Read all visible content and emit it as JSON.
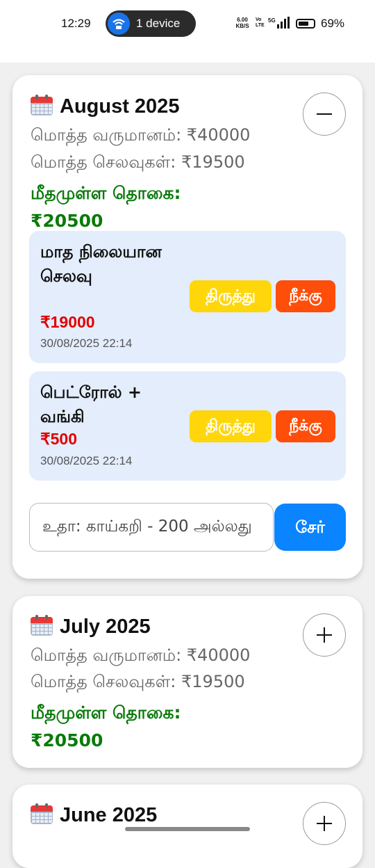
{
  "status_bar": {
    "time": "12:29",
    "device_pill": "1 device",
    "net_speed": "6.00",
    "net_unit": "KB/S",
    "volte": "Vo LTE",
    "signal": "5G",
    "battery_pct": "69%",
    "battery_level": 0.69
  },
  "labels": {
    "total_income": "மொத்த வருமானம்: ₹40000",
    "total_expense": "மொத்த செலவுகள்: ₹19500",
    "balance": "மீதமுள்ள தொகை: ₹20500"
  },
  "months": [
    {
      "title": "August 2025",
      "expanded": true,
      "income": "மொத்த வருமானம்: ₹40000",
      "expense": "மொத்த செலவுகள்: ₹19500",
      "balance": "மீதமுள்ள தொகை: ₹20500",
      "entries": [
        {
          "desc": "மாத நிலையான செலவு",
          "amount": "₹19000",
          "date": "30/08/2025 22:14",
          "edit": "திருத்து",
          "delete": "நீக்கு"
        },
        {
          "desc": "பெட்ரோல் + வங்கி",
          "amount": "₹500",
          "date": "30/08/2025 22:14",
          "edit": "திருத்து",
          "delete": "நீக்கு"
        }
      ],
      "input_placeholder": "உதா: காய்கறி - 200 அல்லது",
      "add_label": "சேர்"
    },
    {
      "title": "July 2025",
      "expanded": false,
      "income": "மொத்த வருமானம்: ₹40000",
      "expense": "மொத்த செலவுகள்: ₹19500",
      "balance": "மீதமுள்ள தொகை: ₹20500"
    },
    {
      "title": "June 2025",
      "expanded": false
    }
  ],
  "icons": {
    "calendar": "calendar-icon",
    "collapse": "minus-icon",
    "expand": "plus-icon"
  },
  "colors": {
    "balance": "#0a7a0a",
    "amount": "#e10000",
    "edit_button": "#ffd60a",
    "delete_button": "#ff4d0a",
    "add_button": "#0a84ff",
    "entry_bg": "#e3edfc"
  }
}
